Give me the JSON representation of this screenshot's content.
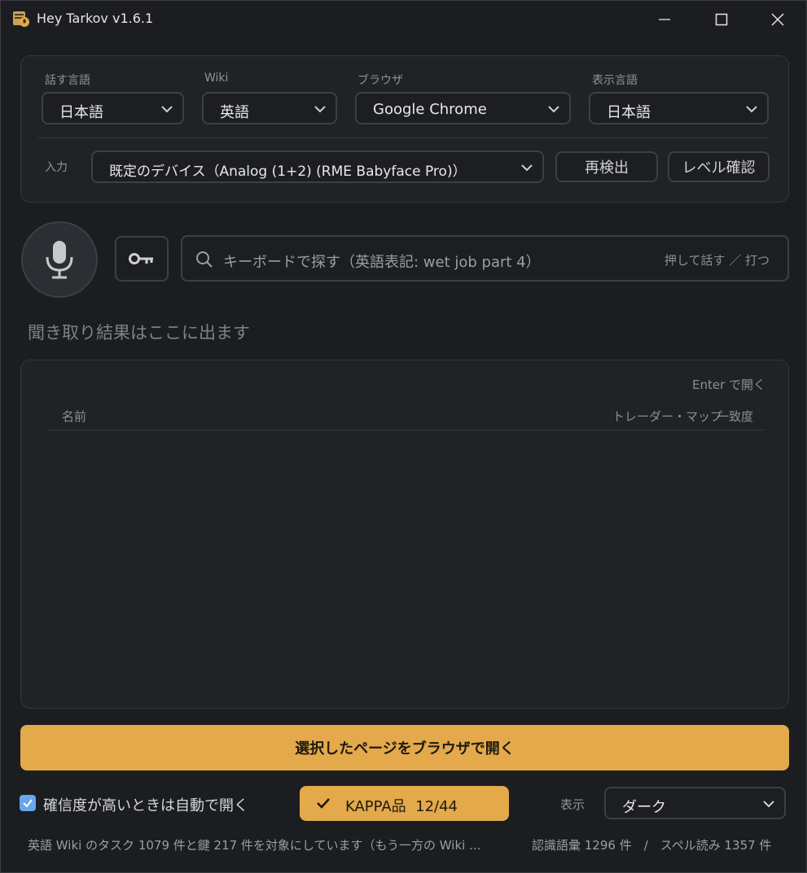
{
  "window": {
    "title": "Hey Tarkov v1.6.1"
  },
  "settings": {
    "speech_language": {
      "label": "話す言語",
      "value": "日本語"
    },
    "wiki": {
      "label": "Wiki",
      "value": "英語"
    },
    "browser": {
      "label": "ブラウザ",
      "value": "Google Chrome"
    },
    "display_language": {
      "label": "表示言語",
      "value": "日本語"
    },
    "input": {
      "label": "入力",
      "value": "既定のデバイス（Analog (1+2) (RME Babyface Pro)）"
    },
    "redetect_label": "再検出",
    "level_check_label": "レベル確認"
  },
  "search": {
    "placeholder": "キーボードで探す（英語表記: wet job part 4）",
    "hint": "押して話す ／ 打つ"
  },
  "listen_placeholder": "聞き取り結果はここに出ます",
  "results": {
    "enter_hint": "Enter で開く",
    "columns": [
      "名前",
      "トレーダー・マップ",
      "一致度"
    ]
  },
  "open_button_label": "選択したページをブラウザで開く",
  "auto_open": {
    "checked": true,
    "label": "確信度が高いときは自動で開く"
  },
  "kappa": {
    "label": "KAPPA品",
    "count": "12/44"
  },
  "display": {
    "label": "表示",
    "value": "ダーク"
  },
  "status": {
    "text": "英語 Wiki のタスク 1079 件と鍵 217 件を対象にしています（もう一方の Wiki ...",
    "stats": "認識語彙 1296 件　/　スペル読み 1357 件"
  },
  "colors": {
    "accent": "#e3a94a",
    "checkbox": "#6aa5ea",
    "background": "#1b1d21"
  },
  "icons": [
    "app-icon",
    "minimize-icon",
    "maximize-icon",
    "close-icon",
    "chevron-down-icon",
    "microphone-icon",
    "key-icon",
    "search-icon",
    "check-icon"
  ]
}
